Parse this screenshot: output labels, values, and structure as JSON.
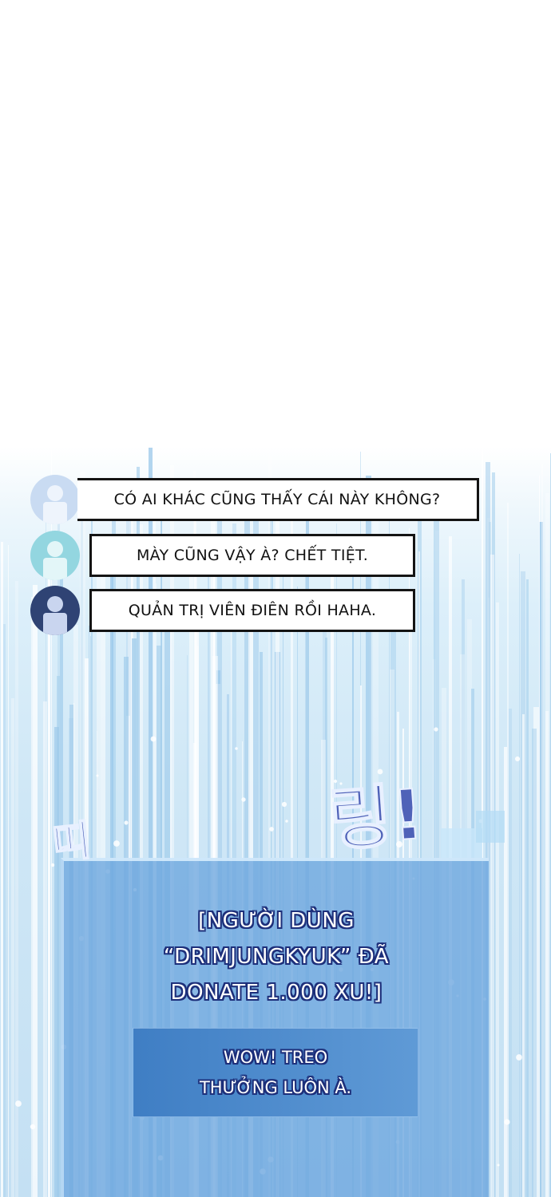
{
  "chat": {
    "messages": [
      {
        "avatar": "user-avatar-light-blue-icon",
        "text": "CÓ AI KHÁC CŨNG THẤY CÁI NÀY KHÔNG?"
      },
      {
        "avatar": "user-avatar-teal-icon",
        "text": "MÀY CŨNG VẬY À? CHẾT TIỆT."
      },
      {
        "avatar": "user-avatar-navy-icon",
        "text": "QUẢN TRỊ VIÊN ĐIÊN RỒI HAHA."
      }
    ]
  },
  "sound_effect": {
    "part1": "띠",
    "part2": "링!"
  },
  "notification": {
    "line1": "[NGƯỜI DÙNG",
    "line2": "“DRIMJUNGKYUK” ĐÃ",
    "line3": "DONATE 1.000 XU!]"
  },
  "reply": {
    "line1": "WOW! TREO",
    "line2": "THƯỞNG LUÔN À."
  },
  "colors": {
    "bubble_border": "#141414",
    "panel": "#6ca5de",
    "text_outline": "#1d2f7a",
    "sfx": "#4f62b8"
  }
}
